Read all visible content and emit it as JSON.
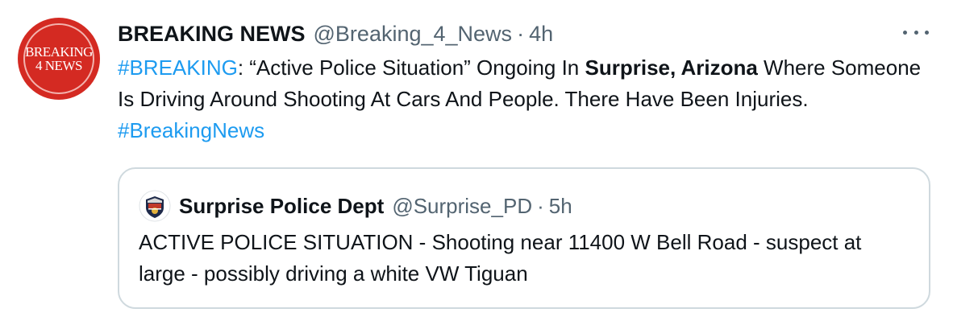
{
  "tweet": {
    "avatar_text_line1": "BREAKING",
    "avatar_text_line2": "4 NEWS",
    "display_name": "BREAKING NEWS",
    "handle": "@Breaking_4_News",
    "separator": "·",
    "time": "4h",
    "more_icon": "more-horizontal-icon",
    "text": {
      "hashtag1": "#BREAKING",
      "part1": ": “Active Police Situation” Ongoing In ",
      "bold_location": "Surprise, Arizona",
      "part2": " Where Someone Is Driving Around Shooting At Cars And People. There Have Been Injuries. ",
      "hashtag2": "#BreakingNews"
    }
  },
  "quoted_tweet": {
    "avatar_icon": "police-badge-icon",
    "display_name": "Surprise Police Dept",
    "handle": "@Surprise_PD",
    "separator": "·",
    "time": "5h",
    "text": "ACTIVE POLICE SITUATION - Shooting near 11400 W Bell Road - suspect at large - possibly driving a white VW Tiguan"
  },
  "colors": {
    "brand_red": "#d42a22",
    "link_blue": "#1d9bf0",
    "secondary_text": "#536471",
    "border": "#cfd9de"
  }
}
